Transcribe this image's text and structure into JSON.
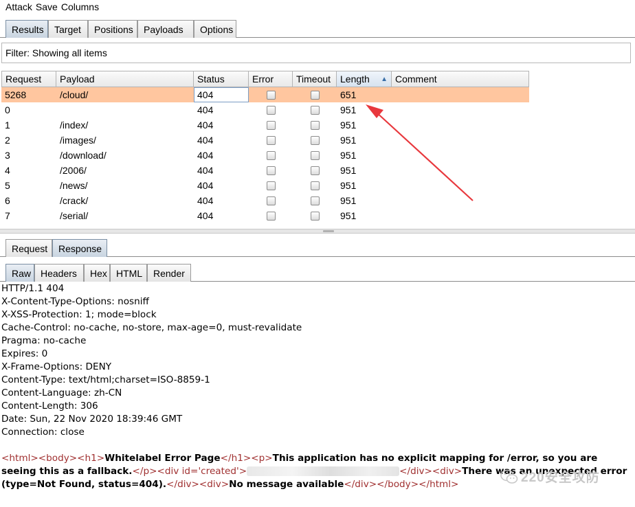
{
  "menu": [
    "Attack",
    "Save",
    "Columns"
  ],
  "top_tabs": [
    "Results",
    "Target",
    "Positions",
    "Payloads",
    "Options"
  ],
  "filter_text": "Filter: Showing all items",
  "table": {
    "columns": [
      "Request",
      "Payload",
      "Status",
      "Error",
      "Timeout",
      "Length",
      "Comment"
    ],
    "sorted_column": "Length",
    "rows": [
      {
        "request": "5268",
        "payload": "/cloud/",
        "status": "404",
        "length": "651"
      },
      {
        "request": "0",
        "payload": "",
        "status": "404",
        "length": "951"
      },
      {
        "request": "1",
        "payload": "/index/",
        "status": "404",
        "length": "951"
      },
      {
        "request": "2",
        "payload": "/images/",
        "status": "404",
        "length": "951"
      },
      {
        "request": "3",
        "payload": "/download/",
        "status": "404",
        "length": "951"
      },
      {
        "request": "4",
        "payload": "/2006/",
        "status": "404",
        "length": "951"
      },
      {
        "request": "5",
        "payload": "/news/",
        "status": "404",
        "length": "951"
      },
      {
        "request": "6",
        "payload": "/crack/",
        "status": "404",
        "length": "951"
      },
      {
        "request": "7",
        "payload": "/serial/",
        "status": "404",
        "length": "951"
      }
    ]
  },
  "req_tabs": [
    "Request",
    "Response"
  ],
  "view_tabs": [
    "Raw",
    "Headers",
    "Hex",
    "HTML",
    "Render"
  ],
  "response": {
    "headers": [
      {
        "name": "HTTP/1.1 404",
        "value": ""
      },
      {
        "name": "X-Content-Type-Options:",
        "value": " nosniff"
      },
      {
        "name": "X-XSS-Protection:",
        "value": " 1; mode=block"
      },
      {
        "name": "Cache-Control:",
        "value": " no-cache, no-store, max-age=0, must-revalidate"
      },
      {
        "name": "Pragma:",
        "value": " no-cache"
      },
      {
        "name": "Expires:",
        "value": " 0"
      },
      {
        "name": "X-Frame-Options:",
        "value": " DENY"
      },
      {
        "name": "Content-Type:",
        "value": " text/html;charset=ISO-8859-1"
      },
      {
        "name": "Content-Language:",
        "value": " zh-CN"
      },
      {
        "name": "Content-Length:",
        "value": " 306"
      },
      {
        "name": "Date:",
        "value": " Sun, 22 Nov 2020 18:39:46 GMT"
      },
      {
        "name": "Connection:",
        "value": " close"
      }
    ],
    "body": {
      "tag_html_open": "<html>",
      "tag_body_open": "<body>",
      "tag_h1_open": "<h1>",
      "h1_text": "Whitelabel Error Page",
      "tag_h1_close": "</h1>",
      "tag_p_open": "<p>",
      "p_text": "This application has no explicit mapping for /error, so you are seeing this as a fallback.",
      "tag_p_close": "</p>",
      "tag_div_id_open": "<div id=",
      "attr_value": "'created'",
      "tag_gt": ">",
      "tag_div_close1": "</div>",
      "tag_div_open2": "<div>",
      "div2_text": "There was an unexpected error (type=Not Found, status=404).",
      "tag_div_close2": "</div>",
      "tag_div_open3": "<div>",
      "div3_text": "No message available",
      "tag_div_close3": "</div>",
      "tag_body_close": "</body>",
      "tag_html_close": "</html>"
    }
  },
  "watermark": "220安全攻防",
  "colors": {
    "selected_row": "#ffc69f",
    "active_tab": "#c8d4e0",
    "annotation_arrow": "#e8383d",
    "tag_color": "#a03030"
  }
}
